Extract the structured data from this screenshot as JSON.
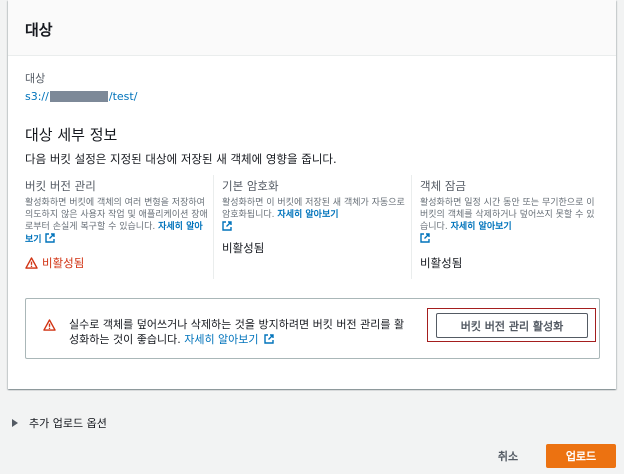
{
  "panel": {
    "title": "대상",
    "destination_label": "대상",
    "destination_prefix": "s3://",
    "destination_suffix": "/test/"
  },
  "details": {
    "title": "대상 세부 정보",
    "description": "다음 버킷 설정은 지정된 대상에 저장된 새 객체에 영향을 줍니다.",
    "columns": [
      {
        "title": "버킷 버전 관리",
        "description": "활성화하면 버킷에 객체의 여러 변형을 저장하여 의도하지 않은 사용자 작업 및 애플리케이션 장애로부터 손실게 복구할 수 있습니다.",
        "learn_more": "자세히 알아보기",
        "status": "비활성됨"
      },
      {
        "title": "기본 암호화",
        "description": "활성화하면 이 버킷에 저장된 새 객체가 자동으로 암호화됩니다.",
        "learn_more": "자세히 알아보기",
        "status": "비활성됨"
      },
      {
        "title": "객체 잠금",
        "description": "활성화하면 일정 시간 동안 또는 무기한으로 이 버킷의 객체를 삭제하거나 덮어쓰지 못할 수 있습니다.",
        "learn_more": "자세히 알아보기",
        "status": "비활성됨"
      }
    ]
  },
  "alert": {
    "text": "실수로 객체를 덮어쓰거나 삭제하는 것을 방지하려면 버킷 버전 관리를 활성화하는 것이 좋습니다.",
    "learn_more": "자세히 알아보기",
    "button_label": "버킷 버전 관리 활성화"
  },
  "additional_options": {
    "label": "추가 업로드 옵션"
  },
  "footer": {
    "cancel_label": "취소",
    "upload_label": "업로드"
  },
  "colors": {
    "link": "#0073bb",
    "warning": "#d13212",
    "primary_button": "#ec7211",
    "highlight_border": "#a41e1e"
  },
  "icons": {
    "external_link": "external-link-icon",
    "warning": "warning-icon",
    "expand": "caret-right-icon"
  }
}
